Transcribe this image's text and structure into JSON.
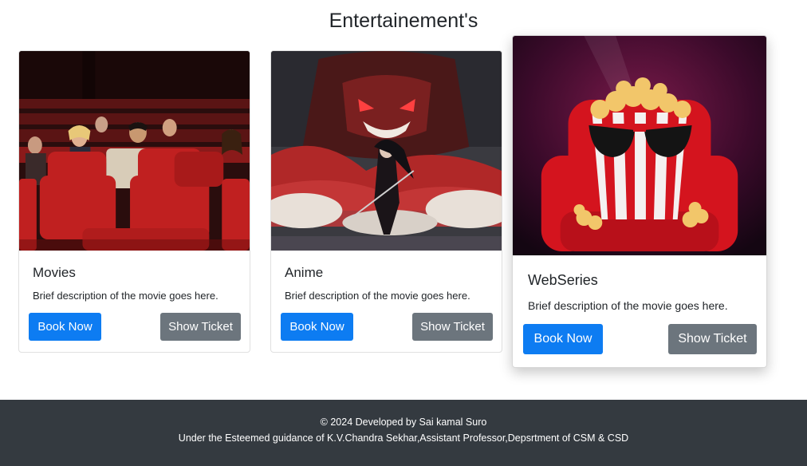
{
  "page": {
    "title": "Entertainement's"
  },
  "cards": [
    {
      "title": "Movies",
      "text": "Brief description of the movie goes here.",
      "primary_label": "Book Now",
      "secondary_label": "Show Ticket",
      "image": "movie-theater-audience-photo"
    },
    {
      "title": "Anime",
      "text": "Brief description of the movie goes here.",
      "primary_label": "Book Now",
      "secondary_label": "Show Ticket",
      "image": "anime-samurai-dragon-art"
    },
    {
      "title": "WebSeries",
      "text": "Brief description of the movie goes here.",
      "primary_label": "Book Now",
      "secondary_label": "Show Ticket",
      "image": "popcorn-sunglasses-chair-art"
    }
  ],
  "footer": {
    "copyright": "© 2024 Developed by Sai kamal Suro",
    "guidance": "Under the Esteemed guidance of K.V.Chandra Sekhar,Assistant Professor,Depsrtment of CSM & CSD"
  },
  "colors": {
    "primary": "#0d7cf2",
    "secondary": "#6c757d",
    "footer_bg": "#343a40"
  }
}
